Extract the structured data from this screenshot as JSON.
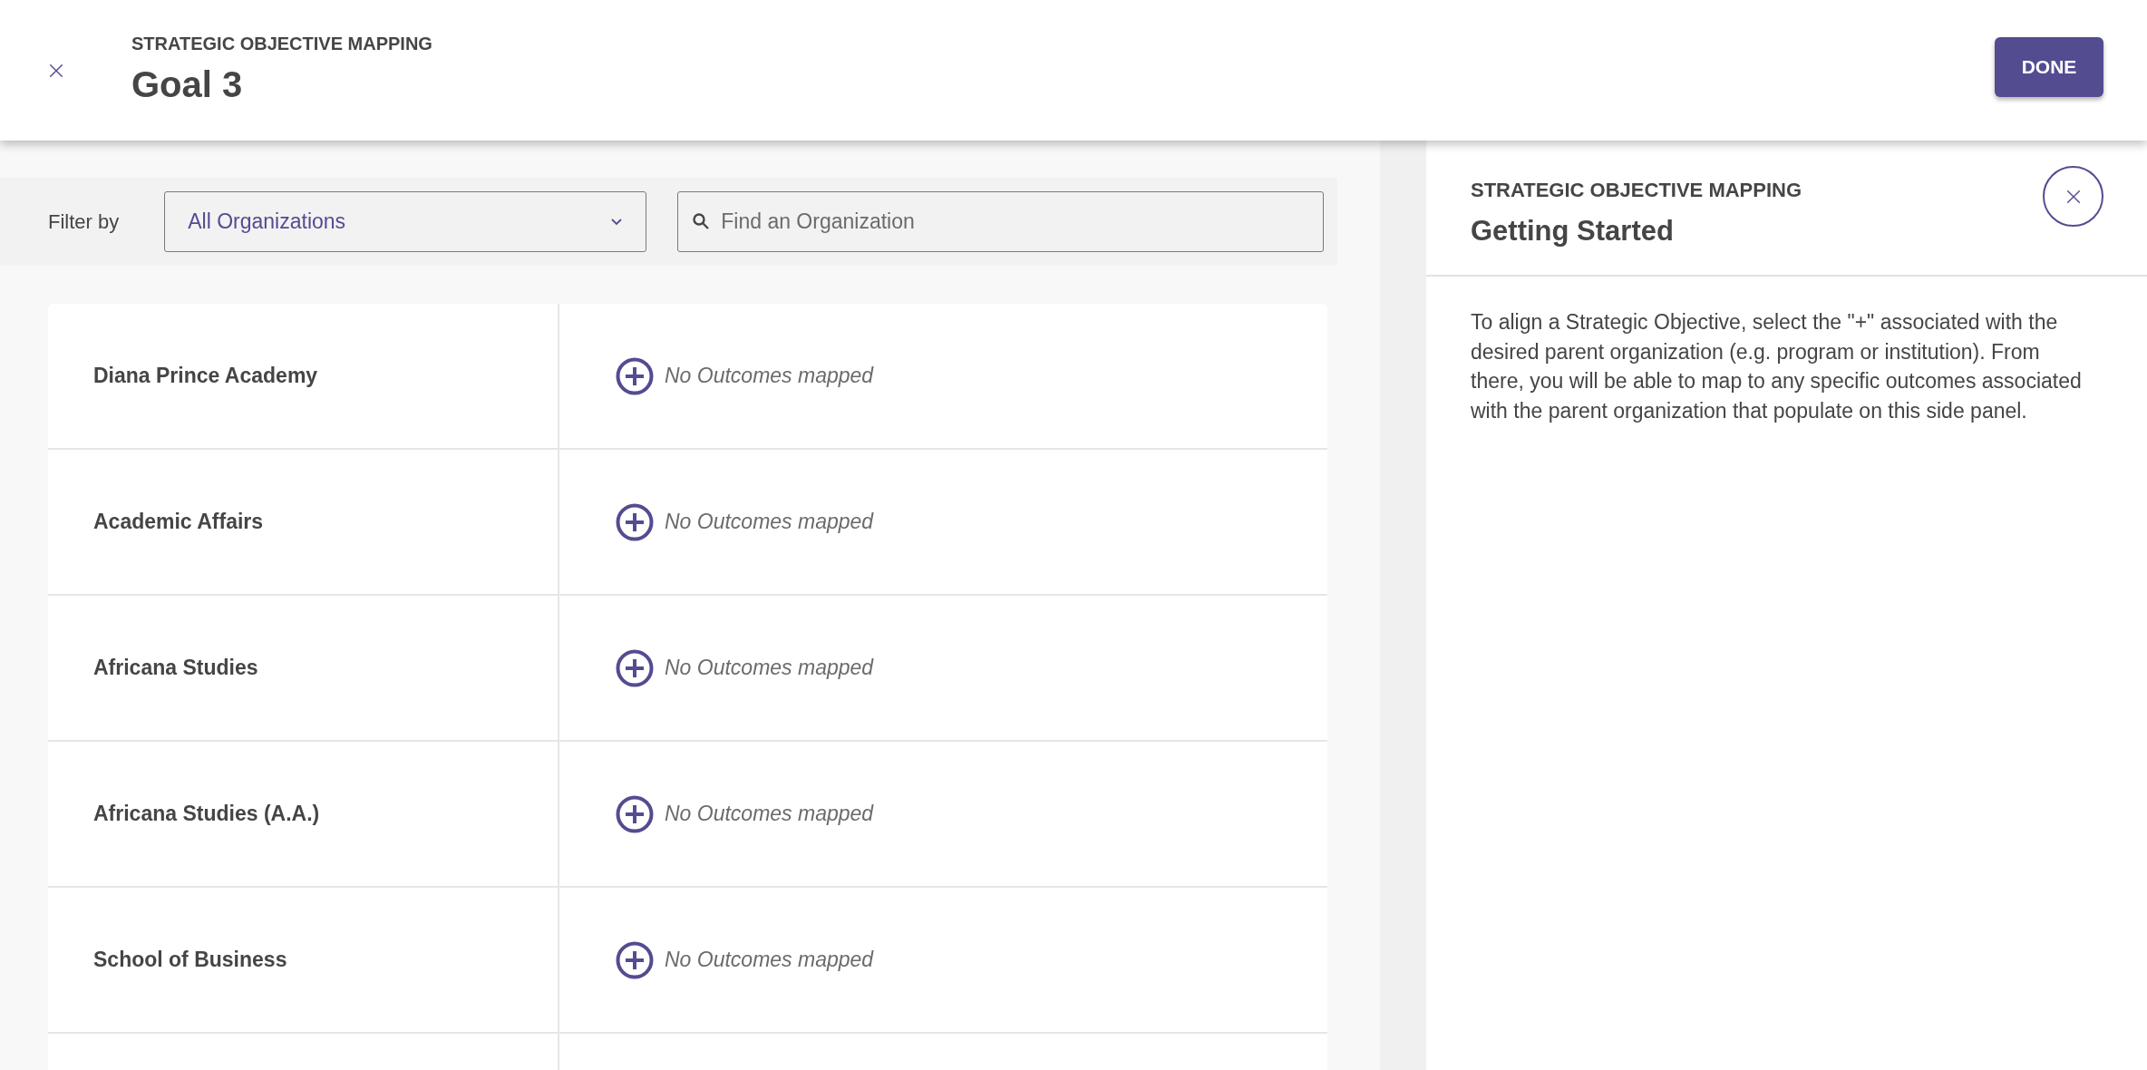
{
  "header": {
    "eyebrow": "STRATEGIC OBJECTIVE MAPPING",
    "title": "Goal 3",
    "done_button": "DONE"
  },
  "filter": {
    "label": "Filter by",
    "dropdown_value": "All Organizations",
    "search_placeholder": "Find an Organization"
  },
  "organizations": [
    {
      "name": "Diana Prince Academy",
      "outcomes": "No Outcomes mapped"
    },
    {
      "name": "Academic Affairs",
      "outcomes": "No Outcomes mapped"
    },
    {
      "name": "Africana Studies",
      "outcomes": "No Outcomes mapped"
    },
    {
      "name": "Africana Studies (A.A.)",
      "outcomes": "No Outcomes mapped"
    },
    {
      "name": "School of Business",
      "outcomes": "No Outcomes mapped"
    }
  ],
  "side_panel": {
    "eyebrow": "STRATEGIC OBJECTIVE MAPPING",
    "title": "Getting Started",
    "body": "To align a Strategic Objective, select the \"+\" associated with the desired parent organization (e.g. program or institution). From there, you will be able to map to any specific outcomes associated with the parent organization that populate on this side panel."
  }
}
